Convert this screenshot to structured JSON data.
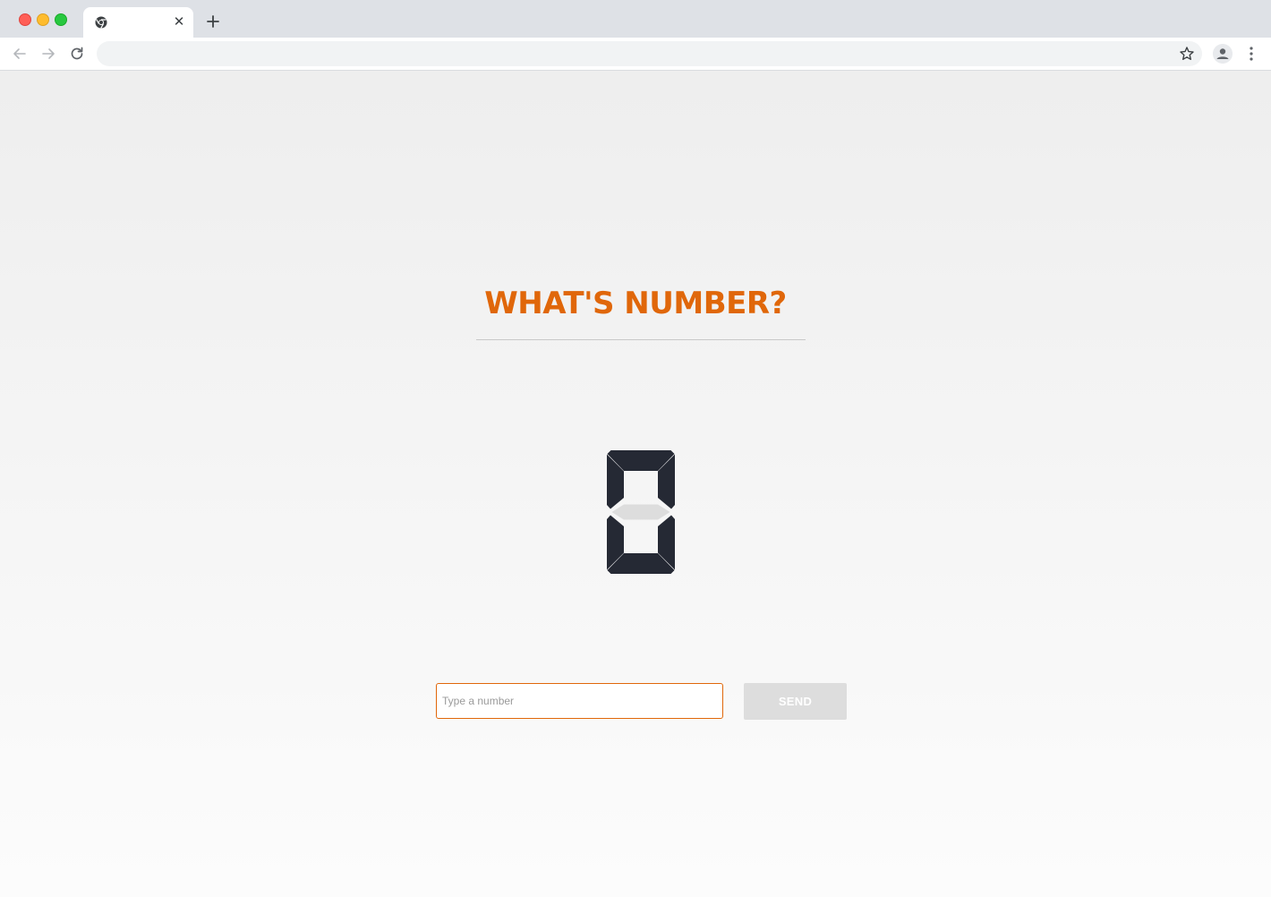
{
  "browser": {
    "tab": {
      "title": "",
      "favicon": "chrome-icon",
      "close_icon": "close-icon"
    },
    "new_tab_icon": "plus-icon",
    "address_bar": {
      "value": ""
    },
    "icons": [
      "back-arrow-icon",
      "forward-arrow-icon",
      "reload-icon",
      "bookmark-star-icon",
      "profile-avatar-icon",
      "kebab-menu-icon"
    ]
  },
  "main": {
    "title": "WHAT'S NUMBER?",
    "display": {
      "digit": 0,
      "segment_on_color": "#252934",
      "segment_off_color": "#dddddd"
    },
    "input": {
      "value": "",
      "placeholder": "Type a number"
    },
    "send_label": "SEND"
  },
  "colors": {
    "accent": "#e0670a",
    "button_disabled": "#dddddd"
  }
}
